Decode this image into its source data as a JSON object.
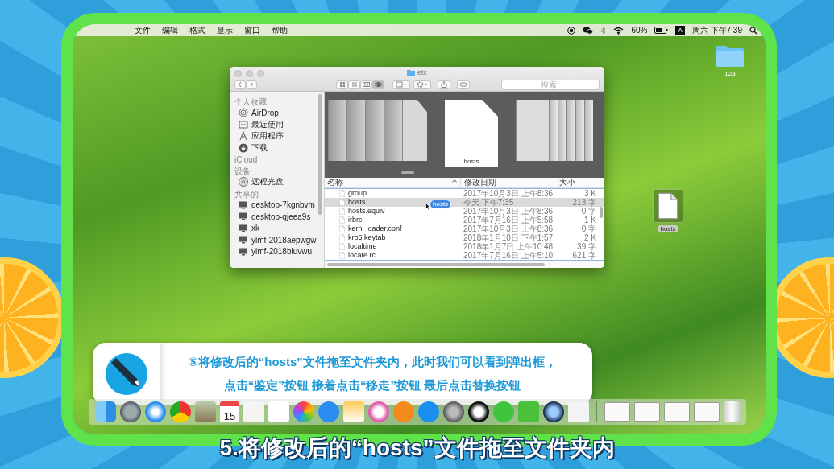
{
  "menu_bar": {
    "menus": [
      "文件",
      "编辑",
      "格式",
      "显示",
      "窗口",
      "帮助"
    ],
    "battery": "60%",
    "input_method": "A",
    "clock": "周六 下午7:39"
  },
  "finder": {
    "title": "etc",
    "search_placeholder": "搜索",
    "sidebar": [
      {
        "heading": "个人收藏",
        "items": [
          {
            "label": "AirDrop",
            "kind": "airdrop"
          },
          {
            "label": "最近使用",
            "kind": "recent"
          },
          {
            "label": "应用程序",
            "kind": "apps"
          },
          {
            "label": "下载",
            "kind": "downloads"
          }
        ]
      },
      {
        "heading": "iCloud"
      },
      {
        "heading": "设备",
        "items": [
          {
            "label": "远程光盘",
            "kind": "disc"
          }
        ]
      },
      {
        "heading": "共享的",
        "items": [
          {
            "label": "desktop-7kgnbvm",
            "kind": "computer"
          },
          {
            "label": "desktop-qjeea9s",
            "kind": "computer"
          },
          {
            "label": "xk",
            "kind": "computer"
          },
          {
            "label": "ylmf-2018aepwgw",
            "kind": "computer"
          },
          {
            "label": "ylmf-2018biuvwu",
            "kind": "computer"
          }
        ]
      }
    ],
    "preview_caption": "hosts",
    "columns": [
      "名称",
      "修改日期",
      "大小"
    ],
    "rows": [
      {
        "name": "group",
        "date": "2017年10月3日 上午8:36",
        "size": "3 K",
        "selected": false
      },
      {
        "name": "hosts",
        "date": "今天 下午7:35",
        "size": "213 字",
        "selected": true
      },
      {
        "name": "hosts.equiv",
        "date": "2017年10月3日 上午8:36",
        "size": "0 字",
        "selected": false
      },
      {
        "name": "irbrc",
        "date": "2017年7月16日 上午5:58",
        "size": "1 K",
        "selected": false
      },
      {
        "name": "kern_loader.conf",
        "date": "2017年10月3日 上午8:36",
        "size": "0 字",
        "selected": false
      },
      {
        "name": "krb5.keytab",
        "date": "2018年1月10日 下午1:57",
        "size": "2 K",
        "selected": false
      },
      {
        "name": "localtime",
        "date": "2018年1月7日 上午10:48",
        "size": "39 字",
        "selected": false
      },
      {
        "name": "locate.rc",
        "date": "2017年7月16日 上午5:10",
        "size": "621 字",
        "selected": false
      }
    ],
    "drag_label": "hosts"
  },
  "desktop_icons": [
    {
      "label": "123",
      "kind": "folder"
    },
    {
      "label": "hosts",
      "kind": "file"
    }
  ],
  "tip": {
    "lines": [
      "⑤将修改后的“hosts”文件拖至文件夹内，此时我们可以看到弹出框，",
      "点击“鉴定”按钮 接着点击“移走”按钮 最后点击替换按钮"
    ]
  },
  "dock": {
    "calendar_day": "15"
  },
  "subtitle": "5.将修改后的“hosts”文件拖至文件夹内"
}
